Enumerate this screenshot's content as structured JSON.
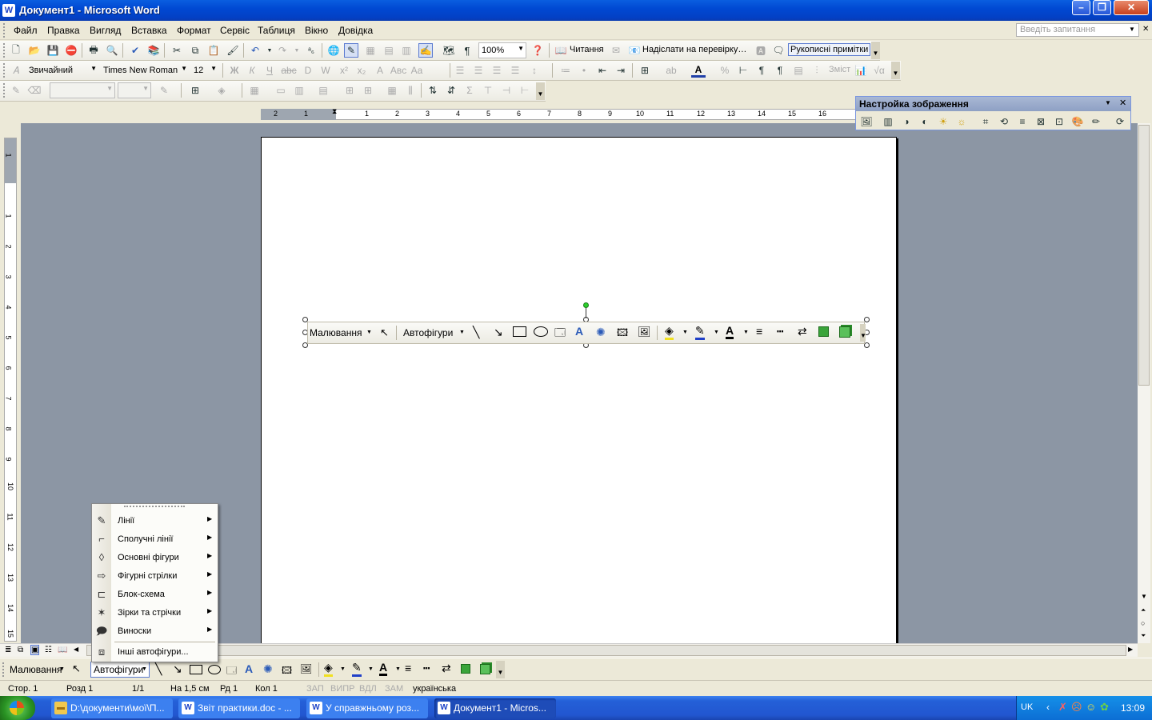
{
  "window": {
    "title": "Документ1 - Microsoft Word",
    "minimize": "–",
    "restore": "❐",
    "close": "✕"
  },
  "menu": {
    "items": [
      "Файл",
      "Правка",
      "Вигляд",
      "Вставка",
      "Формат",
      "Сервіс",
      "Таблиця",
      "Вікно",
      "Довідка"
    ],
    "ask_placeholder": "Введіть запитання"
  },
  "standard_toolbar": {
    "zoom": "100%",
    "reading": "Читання",
    "send_review": "Надіслати на перевірку…",
    "ink_notes": "Рукописні примітки"
  },
  "format_toolbar": {
    "style": "Звичайний",
    "font": "Times New Roman",
    "size": "12",
    "bold": "Ж",
    "italic": "К",
    "underline": "Ч",
    "toc": "Зміст"
  },
  "ruler": {
    "marks": [
      "2",
      "1",
      "1",
      "2",
      "3",
      "4",
      "5",
      "6",
      "7",
      "8",
      "9",
      "10",
      "11",
      "12",
      "13",
      "14",
      "15",
      "16"
    ]
  },
  "ruler_vertical": {
    "marks": [
      "1",
      "1",
      "2",
      "3",
      "4",
      "5",
      "6",
      "7",
      "8",
      "9",
      "10",
      "11",
      "12",
      "13",
      "14",
      "15"
    ]
  },
  "picture_toolbar": {
    "title": "Настройка зображення"
  },
  "floating_toolbar": {
    "draw": "Малювання",
    "autoshapes": "Автофігури"
  },
  "draw_toolbar": {
    "draw": "Малювання",
    "autoshapes": "Автофігури"
  },
  "autoshapes_menu": {
    "items": [
      {
        "label": "Лінії",
        "icon": "lines-icon",
        "sub": true
      },
      {
        "label": "Сполучні лінії",
        "icon": "connectors-icon",
        "sub": true
      },
      {
        "label": "Основні фігури",
        "icon": "basic-shapes-icon",
        "sub": true
      },
      {
        "label": "Фігурні стрілки",
        "icon": "block-arrows-icon",
        "sub": true
      },
      {
        "label": "Блок-схема",
        "icon": "flowchart-icon",
        "sub": true
      },
      {
        "label": "Зірки та стрічки",
        "icon": "stars-banners-icon",
        "sub": true
      },
      {
        "label": "Виноски",
        "icon": "callouts-icon",
        "sub": true
      },
      {
        "label": "Інші автофігури...",
        "icon": "more-autoshapes-icon",
        "sub": false
      }
    ]
  },
  "status": {
    "page": "Стор. 1",
    "section": "Розд 1",
    "pages": "1/1",
    "at": "На 1,5 см",
    "line": "Рд 1",
    "col": "Кол 1",
    "rec": "ЗАП",
    "trk": "ВИПР",
    "ext": "ВДЛ",
    "ovr": "ЗАМ",
    "lang": "українська"
  },
  "taskbar": {
    "tasks": [
      {
        "label": "D:\\документи\\мої\\П...",
        "icon": "folder-icon"
      },
      {
        "label": "Звіт практики.doc - ...",
        "icon": "word-doc-icon"
      },
      {
        "label": "У справжньому роз...",
        "icon": "word-doc-icon"
      },
      {
        "label": "Документ1 - Micros...",
        "icon": "word-doc-icon"
      }
    ],
    "lang": "UK",
    "clock": "13:09"
  },
  "colors": {
    "title_bar": "#0049d3",
    "doc_bg": "#8c96a4",
    "taskbar": "#2256d0",
    "start": "#2a9424"
  }
}
